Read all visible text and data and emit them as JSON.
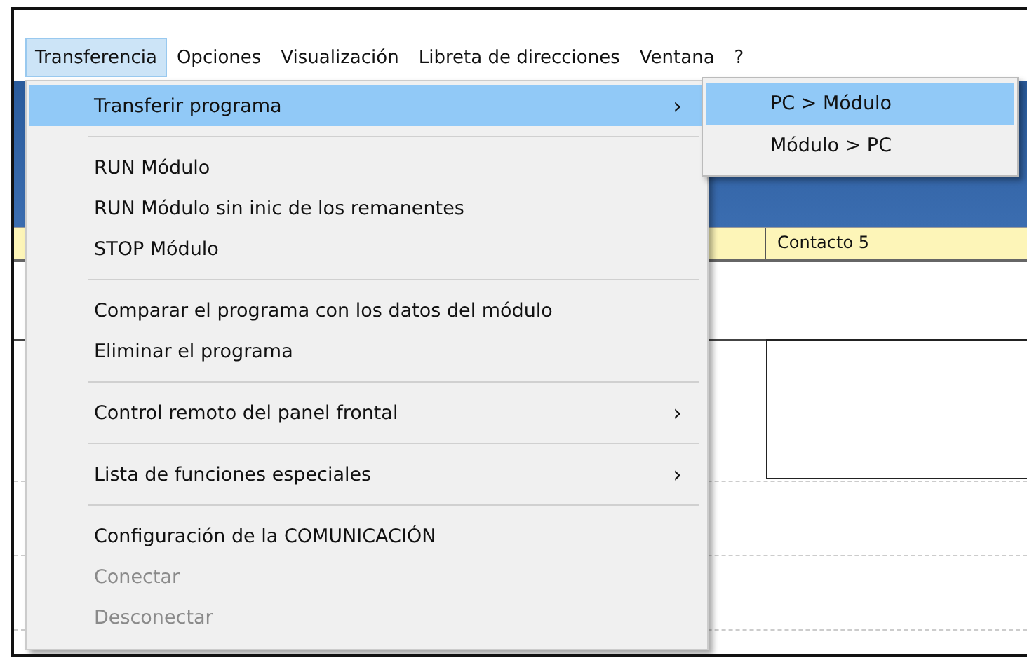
{
  "menu_bar": [
    {
      "label": "Transferencia",
      "selected": true
    },
    {
      "label": "Opciones",
      "selected": false
    },
    {
      "label": "Visualización",
      "selected": false
    },
    {
      "label": "Libreta de direcciones",
      "selected": false
    },
    {
      "label": "Ventana",
      "selected": false
    },
    {
      "label": "?",
      "selected": false
    }
  ],
  "table": {
    "header": "Contacto 5"
  },
  "dropdown": {
    "sections": [
      [
        {
          "label": "Transferir programa",
          "submenu_arrow": "›",
          "selected": true,
          "disabled": false
        }
      ],
      [
        {
          "label": "RUN Módulo",
          "selected": false,
          "disabled": false
        },
        {
          "label": "RUN Módulo sin inic de los remanentes",
          "selected": false,
          "disabled": false
        },
        {
          "label": "STOP Módulo",
          "selected": false,
          "disabled": false
        }
      ],
      [
        {
          "label": "Comparar el programa con los datos del módulo",
          "selected": false,
          "disabled": false
        },
        {
          "label": "Eliminar el programa",
          "selected": false,
          "disabled": false
        }
      ],
      [
        {
          "label": "Control remoto del panel frontal",
          "submenu_arrow": "›",
          "selected": false,
          "disabled": false
        }
      ],
      [
        {
          "label": "Lista de funciones especiales",
          "submenu_arrow": "›",
          "selected": false,
          "disabled": false
        }
      ],
      [
        {
          "label": "Configuración de la COMUNICACIÓN",
          "selected": false,
          "disabled": false
        },
        {
          "label": "Conectar",
          "selected": false,
          "disabled": true
        },
        {
          "label": "Desconectar",
          "selected": false,
          "disabled": true
        }
      ]
    ]
  },
  "submenu": {
    "items": [
      {
        "label": "PC > Módulo",
        "selected": true
      },
      {
        "label": "Módulo > PC",
        "selected": false
      }
    ]
  }
}
